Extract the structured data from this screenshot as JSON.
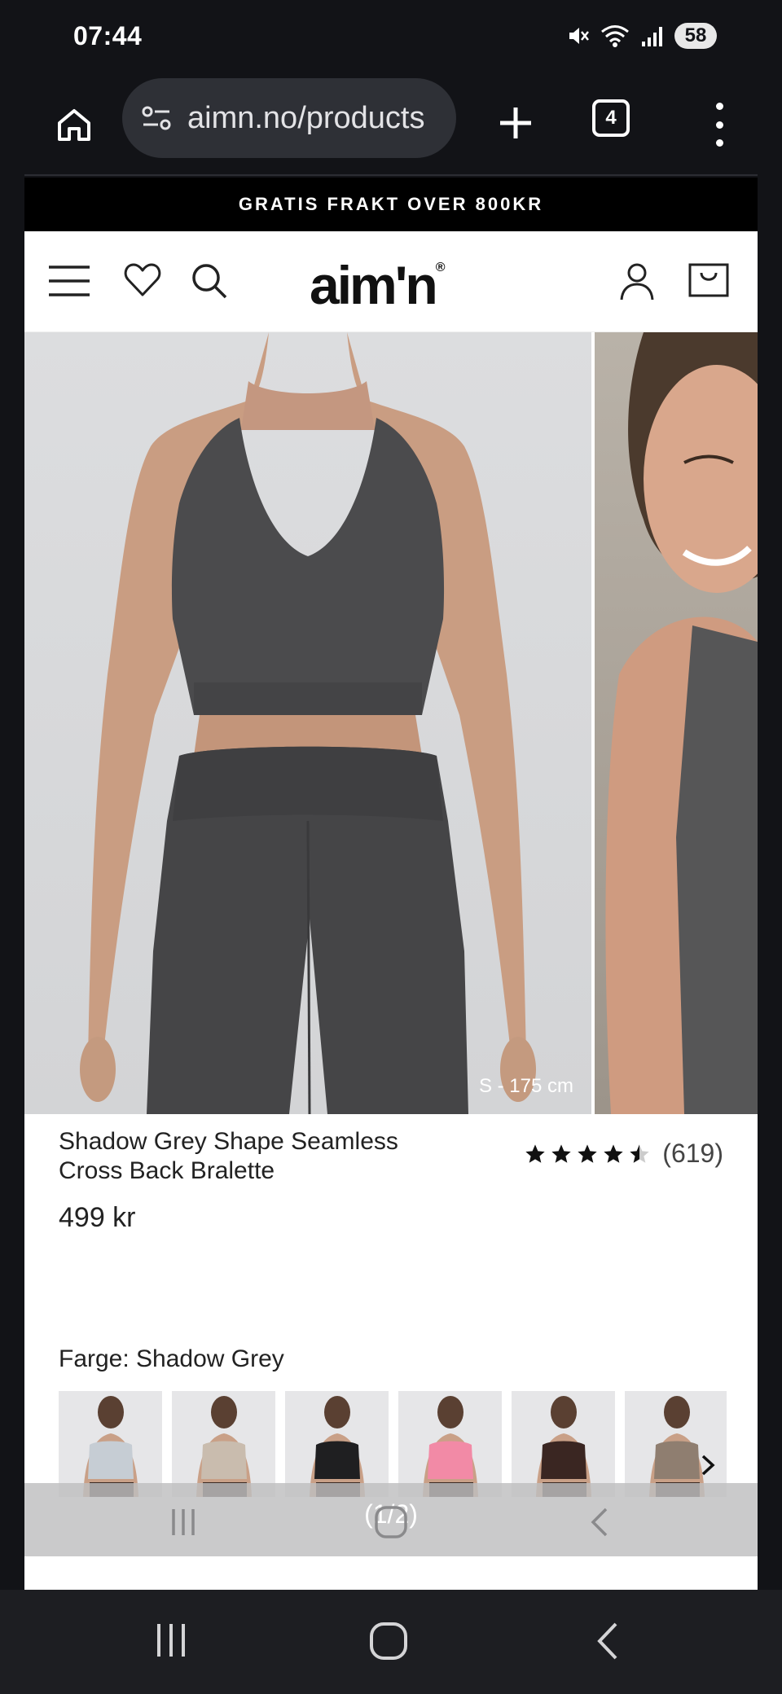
{
  "status": {
    "time": "07:44",
    "battery": "58",
    "icons": [
      "mute-icon",
      "wifi-icon",
      "signal-icon"
    ]
  },
  "browser": {
    "url": "aimn.no/products",
    "tab_count": "4",
    "icons": [
      "home-icon",
      "site-settings-icon",
      "new-tab-icon",
      "tab-switcher-icon",
      "overflow-menu-icon"
    ]
  },
  "promo": {
    "text": "GRATIS FRAKT OVER 800KR"
  },
  "header": {
    "logo": "aim'n",
    "logo_mark": "®",
    "icons": [
      "hamburger-menu-icon",
      "heart-icon",
      "search-icon",
      "account-icon",
      "cart-icon"
    ]
  },
  "gallery": {
    "caption": "S - 175 cm",
    "current": 1,
    "total": 2
  },
  "product": {
    "title": "Shadow Grey Shape Seamless Cross Back Bralette",
    "price": "499 kr",
    "rating_value": 4.5,
    "review_count": "(619)"
  },
  "color": {
    "label": "Farge: Shadow Grey",
    "swatches": [
      {
        "tone": "#c6cdd4"
      },
      {
        "tone": "#c9bcae"
      },
      {
        "tone": "#1f1f21"
      },
      {
        "tone": "#f28aa6"
      },
      {
        "tone": "#3a2622"
      },
      {
        "tone": "#8f7e70"
      }
    ]
  },
  "overlay": {
    "counter": "(1/2)"
  },
  "colors": {
    "os_bg": "#121317",
    "url_box": "#2e3036",
    "promo_bg": "#000000",
    "garment": "#4a4a4c",
    "skin": "#c79b80"
  }
}
